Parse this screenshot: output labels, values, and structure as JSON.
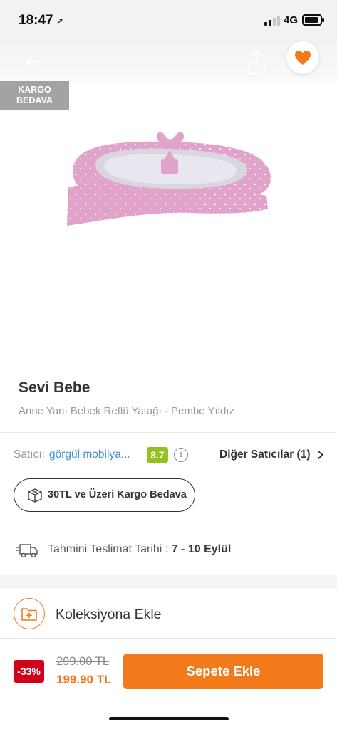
{
  "status_bar": {
    "time": "18:47",
    "network": "4G"
  },
  "badge": {
    "line1": "KARGO",
    "line2": "BEDAVA"
  },
  "product": {
    "brand": "Sevi Bebe",
    "name": "Anne Yanı Bebek Reflü Yatağı - Pembe Yıldız"
  },
  "seller": {
    "label": "Satıcı:",
    "name": "görgül mobilya...",
    "score": "8.7",
    "other_sellers": "Diğer Satıcılar (1)"
  },
  "cargo_pill": {
    "label": "30TL ve Üzeri Kargo Bedava"
  },
  "delivery": {
    "label": "Tahmini Teslimat Tarihi : ",
    "value": "7 - 10 Eylül"
  },
  "collection": {
    "label": "Koleksiyona Ekle"
  },
  "pricing": {
    "discount": "-33%",
    "old_price": "299.00 TL",
    "new_price": "199.90 TL",
    "add_to_cart": "Sepete Ekle"
  },
  "colors": {
    "accent": "#f27a1a",
    "seller_link": "#3e8fdc",
    "score_badge": "#95c11f",
    "discount_badge": "#d0021b"
  },
  "icons": [
    "location-arrow-icon",
    "back-arrow-icon",
    "share-icon",
    "heart-icon",
    "info-icon",
    "chevron-right-icon",
    "box-icon",
    "truck-icon",
    "folder-plus-icon"
  ]
}
